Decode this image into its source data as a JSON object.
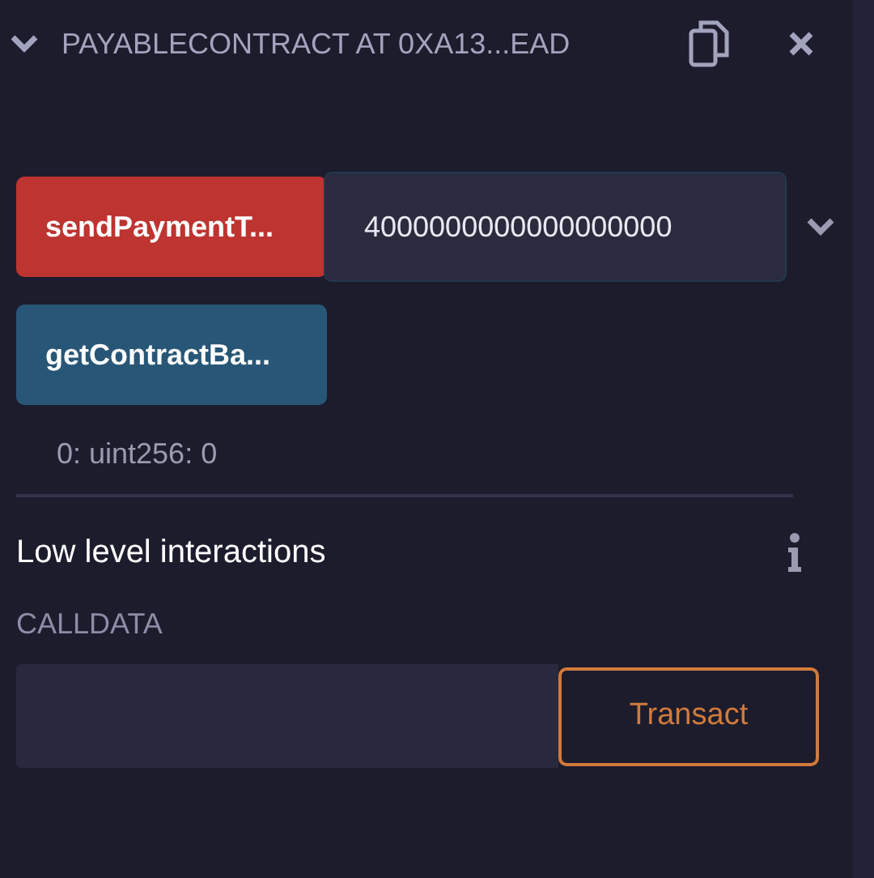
{
  "header": {
    "title": "PAYABLECONTRACT AT 0XA13...EAD",
    "expanded": true
  },
  "functions": [
    {
      "label": "sendPaymentT...",
      "kind": "payable",
      "value": "4000000000000000000"
    },
    {
      "label": "getContractBa...",
      "kind": "view",
      "result": "0: uint256: 0"
    }
  ],
  "low_level": {
    "title": "Low level interactions",
    "calldata_label": "CALLDATA",
    "button": "Transact"
  }
}
